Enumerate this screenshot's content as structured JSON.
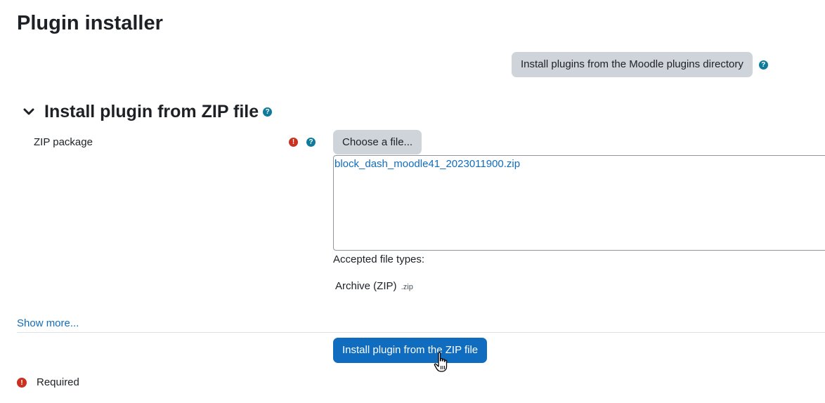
{
  "page": {
    "title": "Plugin installer"
  },
  "directory": {
    "button_label": "Install plugins from the Moodle plugins directory",
    "help_icon": "question-circle-icon"
  },
  "zip_section": {
    "title": "Install plugin from ZIP file",
    "expanded": true,
    "chevron_icon": "chevron-down-icon",
    "help_icon": "question-circle-icon",
    "field_label": "ZIP package",
    "required_icon": "exclamation-circle-icon",
    "choose_button_label": "Choose a file...",
    "selected_file": "block_dash_moodle41_2023011900.zip",
    "accepted_label": "Accepted file types:",
    "accepted_types": [
      {
        "name": "Archive (ZIP)",
        "ext": ".zip"
      }
    ]
  },
  "show_more_label": "Show more...",
  "submit_button_label": "Install plugin from the ZIP file",
  "required_note": {
    "icon": "exclamation-circle-icon",
    "text": "Required"
  },
  "colors": {
    "primary": "#0f6cbf",
    "secondary_button": "#ced4da",
    "help_icon": "#0f7b9a",
    "required_icon": "#ca3120",
    "text": "#1d2125"
  }
}
